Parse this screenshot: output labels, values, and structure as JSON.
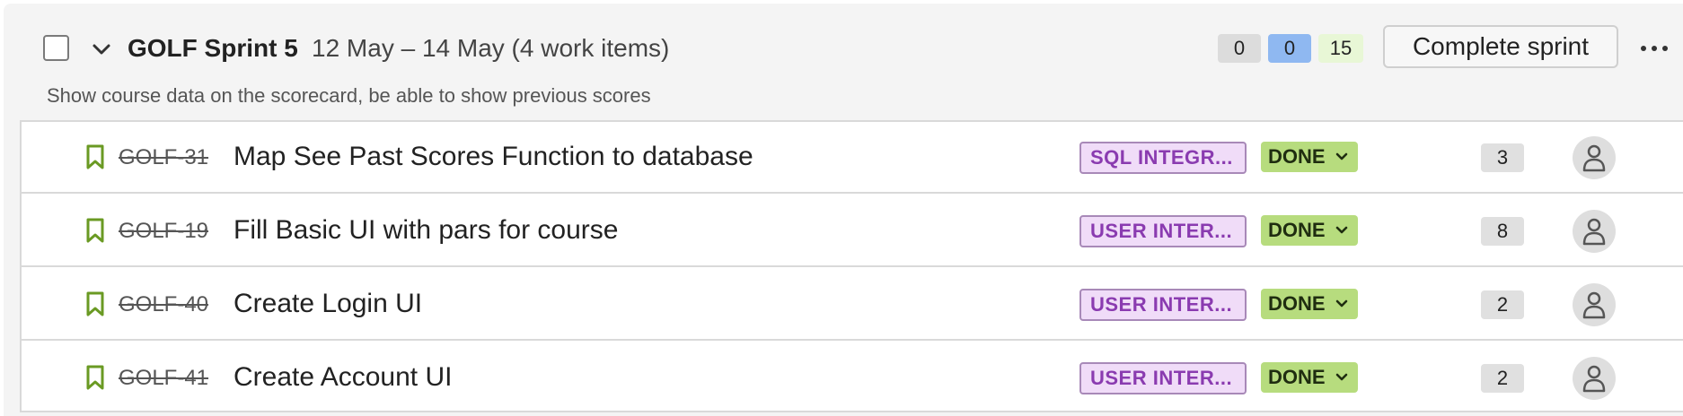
{
  "sprint": {
    "title": "GOLF Sprint 5",
    "dates": "12 May – 14 May (4 work items)",
    "goal": "Show course data on the scorecard, be able to show previous scores",
    "counts": {
      "todo": "0",
      "in_progress": "0",
      "done": "15"
    },
    "complete_label": "Complete sprint"
  },
  "issues": [
    {
      "key": "GOLF-31",
      "summary": "Map See Past Scores Function to database",
      "epic": "SQL INTEGR...",
      "status": "DONE",
      "points": "3"
    },
    {
      "key": "GOLF-19",
      "summary": "Fill Basic UI with pars for course",
      "epic": "USER INTER...",
      "status": "DONE",
      "points": "8"
    },
    {
      "key": "GOLF-40",
      "summary": "Create Login UI",
      "epic": "USER INTER...",
      "status": "DONE",
      "points": "2"
    },
    {
      "key": "GOLF-41",
      "summary": "Create Account UI",
      "epic": "USER INTER...",
      "status": "DONE",
      "points": "2"
    }
  ],
  "colors": {
    "story_icon": "#6a9a23",
    "epic_bg": "#f0dcf8",
    "epic_text": "#8a3bb0",
    "status_done_bg": "#b7dc7e",
    "count_in_progress_bg": "#8fb8f1"
  },
  "icons": {
    "collapse": "chevron-down-icon",
    "more": "more-horizontal-icon",
    "issue_type": "bookmark-icon",
    "assignee": "user-avatar-icon"
  }
}
